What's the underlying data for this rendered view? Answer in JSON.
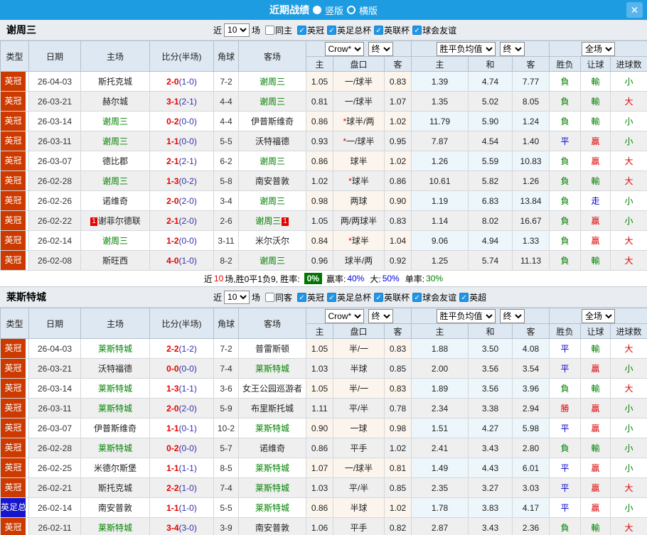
{
  "titlebar": {
    "title": "近期战绩",
    "view_options": [
      {
        "label": "竖版",
        "selected": true
      },
      {
        "label": "横版",
        "selected": false
      }
    ],
    "close_label": "✕"
  },
  "table_header": {
    "cols": [
      "类型",
      "日期",
      "主场",
      "比分(半场)",
      "角球",
      "客场"
    ],
    "sub_cols": [
      "主",
      "盘口",
      "客",
      "主",
      "和",
      "客",
      "胜负",
      "让球",
      "进球数"
    ],
    "dropdown_company": "Crow*",
    "dropdown_final1": "终",
    "dropdown_avg": "胜平负均值",
    "dropdown_final2": "终",
    "dropdown_scope": "全场"
  },
  "league_colors": {
    "英冠": "#cc3a00",
    "英足总杯": "#1515cc"
  },
  "result_colors": {
    "win": "#dd0000",
    "draw": "#0000cc",
    "loss": "#008000",
    "big": "#dd0000",
    "small": "#008000"
  },
  "sections": [
    {
      "team": "谢周三",
      "filter": {
        "near": "近",
        "count": "10",
        "unit": "场",
        "same": {
          "label": "同主",
          "checked": false
        },
        "leagues": [
          {
            "label": "英冠",
            "checked": true
          },
          {
            "label": "英足总杯",
            "checked": true
          },
          {
            "label": "英联杯",
            "checked": true
          },
          {
            "label": "球会友谊",
            "checked": true
          }
        ]
      },
      "rows": [
        {
          "league": "英冠",
          "date": "26-04-03",
          "home": "斯托克城",
          "home_self": false,
          "home_rc": "",
          "score": "2-0",
          "half": "(1-0)",
          "corner": "7-2",
          "away": "谢周三",
          "away_self": true,
          "away_rc": "",
          "h_odds": "1.05",
          "handicap": "一/球半",
          "handicap_star": false,
          "a_odds": "0.83",
          "avg_h": "1.39",
          "avg_d": "4.74",
          "avg_a": "7.77",
          "result": "負",
          "handicap_result": "輸",
          "goals": "小"
        },
        {
          "league": "英冠",
          "date": "26-03-21",
          "home": "赫尔城",
          "home_self": false,
          "home_rc": "",
          "score": "3-1",
          "half": "(2-1)",
          "corner": "4-4",
          "away": "谢周三",
          "away_self": true,
          "away_rc": "",
          "h_odds": "0.81",
          "handicap": "一/球半",
          "handicap_star": false,
          "a_odds": "1.07",
          "avg_h": "1.35",
          "avg_d": "5.02",
          "avg_a": "8.05",
          "result": "負",
          "handicap_result": "輸",
          "goals": "大"
        },
        {
          "league": "英冠",
          "date": "26-03-14",
          "home": "谢周三",
          "home_self": true,
          "home_rc": "",
          "score": "0-2",
          "half": "(0-0)",
          "corner": "4-4",
          "away": "伊普斯维奇",
          "away_self": false,
          "away_rc": "",
          "h_odds": "0.86",
          "handicap": "球半/两",
          "handicap_star": true,
          "a_odds": "1.02",
          "avg_h": "11.79",
          "avg_d": "5.90",
          "avg_a": "1.24",
          "result": "負",
          "handicap_result": "輸",
          "goals": "小"
        },
        {
          "league": "英冠",
          "date": "26-03-11",
          "home": "谢周三",
          "home_self": true,
          "home_rc": "",
          "score": "1-1",
          "half": "(0-0)",
          "corner": "5-5",
          "away": "沃特福德",
          "away_self": false,
          "away_rc": "",
          "h_odds": "0.93",
          "handicap": "一/球半",
          "handicap_star": true,
          "a_odds": "0.95",
          "avg_h": "7.87",
          "avg_d": "4.54",
          "avg_a": "1.40",
          "result": "平",
          "handicap_result": "贏",
          "goals": "小"
        },
        {
          "league": "英冠",
          "date": "26-03-07",
          "home": "德比郡",
          "home_self": false,
          "home_rc": "",
          "score": "2-1",
          "half": "(2-1)",
          "corner": "6-2",
          "away": "谢周三",
          "away_self": true,
          "away_rc": "",
          "h_odds": "0.86",
          "handicap": "球半",
          "handicap_star": false,
          "a_odds": "1.02",
          "avg_h": "1.26",
          "avg_d": "5.59",
          "avg_a": "10.83",
          "result": "負",
          "handicap_result": "贏",
          "goals": "大"
        },
        {
          "league": "英冠",
          "date": "26-02-28",
          "home": "谢周三",
          "home_self": true,
          "home_rc": "",
          "score": "1-3",
          "half": "(0-2)",
          "corner": "5-8",
          "away": "南安普敦",
          "away_self": false,
          "away_rc": "",
          "h_odds": "1.02",
          "handicap": "球半",
          "handicap_star": true,
          "a_odds": "0.86",
          "avg_h": "10.61",
          "avg_d": "5.82",
          "avg_a": "1.26",
          "result": "負",
          "handicap_result": "輸",
          "goals": "大"
        },
        {
          "league": "英冠",
          "date": "26-02-26",
          "home": "诺维奇",
          "home_self": false,
          "home_rc": "",
          "score": "2-0",
          "half": "(2-0)",
          "corner": "3-4",
          "away": "谢周三",
          "away_self": true,
          "away_rc": "",
          "h_odds": "0.98",
          "handicap": "两球",
          "handicap_star": false,
          "a_odds": "0.90",
          "avg_h": "1.19",
          "avg_d": "6.83",
          "avg_a": "13.84",
          "result": "負",
          "handicap_result": "走",
          "goals": "小"
        },
        {
          "league": "英冠",
          "date": "26-02-22",
          "home": "谢菲尔德联",
          "home_self": false,
          "home_rc": "1",
          "score": "2-1",
          "half": "(2-0)",
          "corner": "2-6",
          "away": "谢周三",
          "away_self": true,
          "away_rc": "1",
          "h_odds": "1.05",
          "handicap": "两/两球半",
          "handicap_star": false,
          "a_odds": "0.83",
          "avg_h": "1.14",
          "avg_d": "8.02",
          "avg_a": "16.67",
          "result": "負",
          "handicap_result": "贏",
          "goals": "小"
        },
        {
          "league": "英冠",
          "date": "26-02-14",
          "home": "谢周三",
          "home_self": true,
          "home_rc": "",
          "score": "1-2",
          "half": "(0-0)",
          "corner": "3-11",
          "away": "米尔沃尔",
          "away_self": false,
          "away_rc": "",
          "h_odds": "0.84",
          "handicap": "球半",
          "handicap_star": true,
          "a_odds": "1.04",
          "avg_h": "9.06",
          "avg_d": "4.94",
          "avg_a": "1.33",
          "result": "負",
          "handicap_result": "贏",
          "goals": "大"
        },
        {
          "league": "英冠",
          "date": "26-02-08",
          "home": "斯旺西",
          "home_self": false,
          "home_rc": "",
          "score": "4-0",
          "half": "(1-0)",
          "corner": "8-2",
          "away": "谢周三",
          "away_self": true,
          "away_rc": "",
          "h_odds": "0.96",
          "handicap": "球半/两",
          "handicap_star": false,
          "a_odds": "0.92",
          "avg_h": "1.25",
          "avg_d": "5.74",
          "avg_a": "11.13",
          "result": "負",
          "handicap_result": "輸",
          "goals": "大"
        }
      ],
      "summary": {
        "t1": "近",
        "t2": "10",
        "t3": "场,胜0平1负9, 胜率:",
        "rate": "0%",
        "t4": "赢率:",
        "v4": "40%",
        "t5": "大:",
        "v5": "50%",
        "t6": "单率:",
        "v6": "30%"
      }
    },
    {
      "team": "莱斯特城",
      "filter": {
        "near": "近",
        "count": "10",
        "unit": "场",
        "same": {
          "label": "同客",
          "checked": false
        },
        "leagues": [
          {
            "label": "英冠",
            "checked": true
          },
          {
            "label": "英足总杯",
            "checked": true
          },
          {
            "label": "英联杯",
            "checked": true
          },
          {
            "label": "球会友谊",
            "checked": true
          },
          {
            "label": "英超",
            "checked": true
          }
        ]
      },
      "rows": [
        {
          "league": "英冠",
          "date": "26-04-03",
          "home": "莱斯特城",
          "home_self": true,
          "home_rc": "",
          "score": "2-2",
          "half": "(1-2)",
          "corner": "7-2",
          "away": "普雷斯顿",
          "away_self": false,
          "away_rc": "",
          "h_odds": "1.05",
          "handicap": "半/一",
          "handicap_star": false,
          "a_odds": "0.83",
          "avg_h": "1.88",
          "avg_d": "3.50",
          "avg_a": "4.08",
          "result": "平",
          "handicap_result": "輸",
          "goals": "大"
        },
        {
          "league": "英冠",
          "date": "26-03-21",
          "home": "沃特福德",
          "home_self": false,
          "home_rc": "",
          "score": "0-0",
          "half": "(0-0)",
          "corner": "7-4",
          "away": "莱斯特城",
          "away_self": true,
          "away_rc": "",
          "h_odds": "1.03",
          "handicap": "半球",
          "handicap_star": false,
          "a_odds": "0.85",
          "avg_h": "2.00",
          "avg_d": "3.56",
          "avg_a": "3.54",
          "result": "平",
          "handicap_result": "贏",
          "goals": "小"
        },
        {
          "league": "英冠",
          "date": "26-03-14",
          "home": "莱斯特城",
          "home_self": true,
          "home_rc": "",
          "score": "1-3",
          "half": "(1-1)",
          "corner": "3-6",
          "away": "女王公园巡游者",
          "away_self": false,
          "away_rc": "",
          "h_odds": "1.05",
          "handicap": "半/一",
          "handicap_star": false,
          "a_odds": "0.83",
          "avg_h": "1.89",
          "avg_d": "3.56",
          "avg_a": "3.96",
          "result": "負",
          "handicap_result": "輸",
          "goals": "大"
        },
        {
          "league": "英冠",
          "date": "26-03-11",
          "home": "莱斯特城",
          "home_self": true,
          "home_rc": "",
          "score": "2-0",
          "half": "(2-0)",
          "corner": "5-9",
          "away": "布里斯托城",
          "away_self": false,
          "away_rc": "",
          "h_odds": "1.11",
          "handicap": "平/半",
          "handicap_star": false,
          "a_odds": "0.78",
          "avg_h": "2.34",
          "avg_d": "3.38",
          "avg_a": "2.94",
          "result": "勝",
          "handicap_result": "贏",
          "goals": "小"
        },
        {
          "league": "英冠",
          "date": "26-03-07",
          "home": "伊普斯维奇",
          "home_self": false,
          "home_rc": "",
          "score": "1-1",
          "half": "(0-1)",
          "corner": "10-2",
          "away": "莱斯特城",
          "away_self": true,
          "away_rc": "",
          "h_odds": "0.90",
          "handicap": "一球",
          "handicap_star": false,
          "a_odds": "0.98",
          "avg_h": "1.51",
          "avg_d": "4.27",
          "avg_a": "5.98",
          "result": "平",
          "handicap_result": "贏",
          "goals": "小"
        },
        {
          "league": "英冠",
          "date": "26-02-28",
          "home": "莱斯特城",
          "home_self": true,
          "home_rc": "",
          "score": "0-2",
          "half": "(0-0)",
          "corner": "5-7",
          "away": "诺维奇",
          "away_self": false,
          "away_rc": "",
          "h_odds": "0.86",
          "handicap": "平手",
          "handicap_star": false,
          "a_odds": "1.02",
          "avg_h": "2.41",
          "avg_d": "3.43",
          "avg_a": "2.80",
          "result": "負",
          "handicap_result": "輸",
          "goals": "小"
        },
        {
          "league": "英冠",
          "date": "26-02-25",
          "home": "米德尔斯堡",
          "home_self": false,
          "home_rc": "",
          "score": "1-1",
          "half": "(1-1)",
          "corner": "8-5",
          "away": "莱斯特城",
          "away_self": true,
          "away_rc": "",
          "h_odds": "1.07",
          "handicap": "一/球半",
          "handicap_star": false,
          "a_odds": "0.81",
          "avg_h": "1.49",
          "avg_d": "4.43",
          "avg_a": "6.01",
          "result": "平",
          "handicap_result": "贏",
          "goals": "小"
        },
        {
          "league": "英冠",
          "date": "26-02-21",
          "home": "斯托克城",
          "home_self": false,
          "home_rc": "",
          "score": "2-2",
          "half": "(1-0)",
          "corner": "7-4",
          "away": "莱斯特城",
          "away_self": true,
          "away_rc": "",
          "h_odds": "1.03",
          "handicap": "平/半",
          "handicap_star": false,
          "a_odds": "0.85",
          "avg_h": "2.35",
          "avg_d": "3.27",
          "avg_a": "3.03",
          "result": "平",
          "handicap_result": "贏",
          "goals": "大"
        },
        {
          "league": "英足总杯",
          "date": "26-02-14",
          "home": "南安普敦",
          "home_self": false,
          "home_rc": "",
          "score": "1-1",
          "half": "(1-0)",
          "corner": "5-5",
          "away": "莱斯特城",
          "away_self": true,
          "away_rc": "",
          "h_odds": "0.86",
          "handicap": "半球",
          "handicap_star": false,
          "a_odds": "1.02",
          "avg_h": "1.78",
          "avg_d": "3.83",
          "avg_a": "4.17",
          "result": "平",
          "handicap_result": "贏",
          "goals": "小"
        },
        {
          "league": "英冠",
          "date": "26-02-11",
          "home": "莱斯特城",
          "home_self": true,
          "home_rc": "",
          "score": "3-4",
          "half": "(3-0)",
          "corner": "3-9",
          "away": "南安普敦",
          "away_self": false,
          "away_rc": "",
          "h_odds": "1.06",
          "handicap": "平手",
          "handicap_star": false,
          "a_odds": "0.82",
          "avg_h": "2.87",
          "avg_d": "3.43",
          "avg_a": "2.36",
          "result": "負",
          "handicap_result": "輸",
          "goals": "大"
        }
      ],
      "summary": null
    }
  ]
}
